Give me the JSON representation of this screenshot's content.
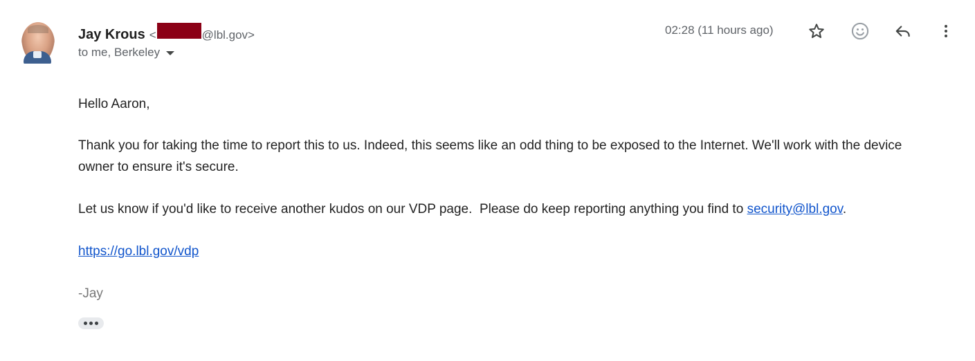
{
  "sender": {
    "name": "Jay Krous",
    "email_prefix": "<",
    "email_domain": "@lbl.gov>"
  },
  "recipients": {
    "label": "to me, Berkeley"
  },
  "timestamp": "02:28 (11 hours ago)",
  "actions": {
    "star": "star-icon",
    "react": "emoji-icon",
    "reply": "reply-icon",
    "more": "more-vert-icon"
  },
  "body": {
    "greeting": "Hello Aaron,",
    "thanks": "Thank you for taking the time to report this to us. Indeed, this seems like an odd thing to be exposed to the Internet. We'll work with the device owner to ensure it's secure.",
    "kudos_prefix": "Let us know if you'd like to receive another kudos on our VDP page.  Please do keep reporting anything you find to ",
    "kudos_link": "security@lbl.gov",
    "kudos_suffix": ".",
    "link": "https://go.lbl.gov/vdp",
    "signature": "-Jay"
  },
  "colors": {
    "link": "#1155cc",
    "redaction": "#8b0016",
    "secondary_text": "#5f6368"
  }
}
